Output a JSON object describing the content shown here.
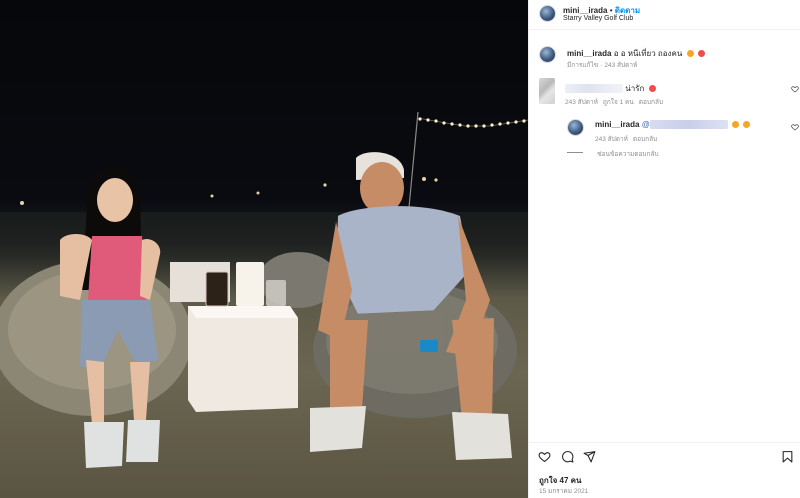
{
  "post": {
    "username": "mini__irada",
    "separator": "•",
    "follow_label": "ติดตาม",
    "location": "Starry Valley Golf Club"
  },
  "caption": {
    "username": "mini__irada",
    "text": "อ อ หนีเที่ยว ถองคน",
    "meta_edited": "มีการแก้ไข",
    "meta_sep": "·",
    "meta_time": "243 สัปดาห์"
  },
  "comment": {
    "text": "น่ารัก",
    "time": "243 สัปดาห์",
    "likes": "ถูกใจ 1 คน",
    "reply_label": "ตอบกลับ"
  },
  "reply": {
    "username": "mini__irada",
    "at": "@",
    "time": "243 สัปดาห์",
    "reply_label": "ตอบกลับ"
  },
  "hide_replies": "ซ่อนข้อความตอบกลับ",
  "footer": {
    "likes": "ถูกใจ 47 คน",
    "date": "15 มกราคม 2021"
  },
  "icons": {
    "like": "heart-icon",
    "comment": "comment-icon",
    "share": "share-icon",
    "save": "bookmark-icon"
  },
  "colors": {
    "accent": "#0095f6",
    "muted": "#8e8e8e",
    "text": "#262626"
  }
}
